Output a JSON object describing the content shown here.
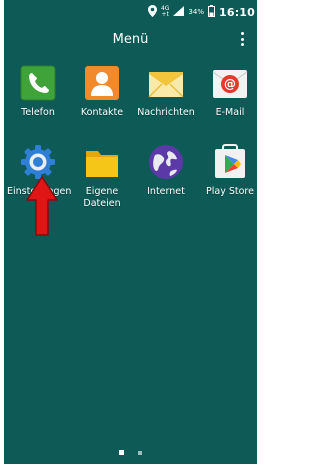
{
  "status_bar": {
    "network_top": "4G",
    "network_bottom": "+t",
    "battery": "34%",
    "time": "16:10"
  },
  "header": {
    "title": "Menü",
    "overflow_icon": "more-vert-icon"
  },
  "apps": [
    {
      "label": "Telefon",
      "icon": "phone-icon",
      "color": "#3fa33a"
    },
    {
      "label": "Kontakte",
      "icon": "contacts-icon",
      "color": "#f08a2b"
    },
    {
      "label": "Nachrichten",
      "icon": "messages-icon",
      "color": "#f2c53d"
    },
    {
      "label": "E-Mail",
      "icon": "email-icon",
      "color": "#e23b2e"
    },
    {
      "label": "Einstellungen",
      "icon": "settings-gear-icon",
      "color": "#2f7fd6"
    },
    {
      "label": "Eigene\nDateien",
      "icon": "folder-icon",
      "color": "#f5c518"
    },
    {
      "label": "Internet",
      "icon": "globe-icon",
      "color": "#5b3aa8"
    },
    {
      "label": "Play Store",
      "icon": "play-store-icon",
      "color": "#34a853"
    }
  ],
  "annotation": {
    "icon": "red-arrow-icon",
    "color": "#e01515"
  },
  "pager": {
    "pages": 2,
    "current": 1
  },
  "theme": {
    "background": "#0e5a57"
  }
}
